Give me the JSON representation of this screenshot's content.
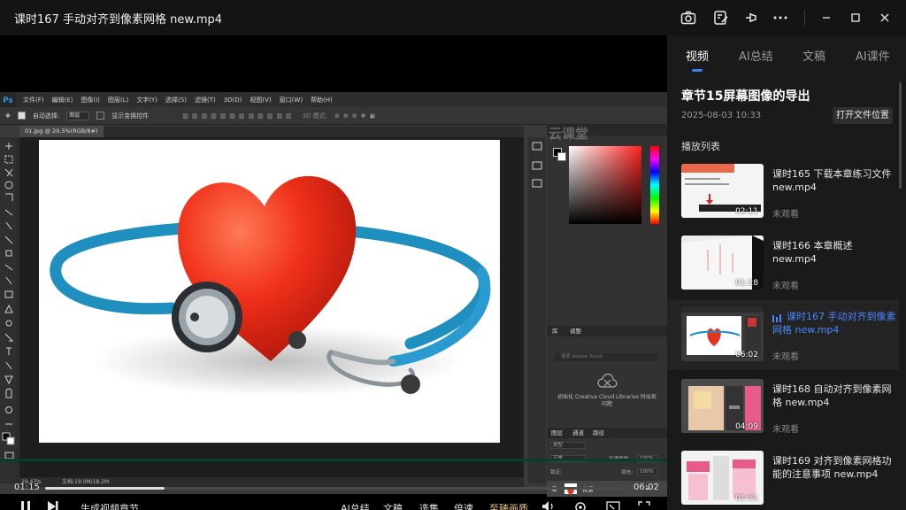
{
  "window": {
    "title": "课时167 手动对齐到像素网格 new.mp4",
    "buttons": [
      "camera-icon",
      "edit-note-icon",
      "pin-icon",
      "more-icon",
      "minimize-icon",
      "maximize-icon",
      "close-icon"
    ]
  },
  "photoshop": {
    "logo": "Ps",
    "menus": [
      "文件(F)",
      "编辑(E)",
      "图像(I)",
      "图层(L)",
      "文字(Y)",
      "选择(S)",
      "滤镜(T)",
      "3D(D)",
      "视图(V)",
      "窗口(W)",
      "帮助(H)"
    ],
    "options": {
      "auto_select": "自动选择:",
      "layer_select": "图层",
      "show_transform": "显示变换控件",
      "mode_3d": "3D 模式:"
    },
    "doc_tab": "01.jpg @ 29.5%(RGB/8#)",
    "status_zoom": "29.47%",
    "status_doc": "文档:19.0M/18.2M",
    "panel_tabs_lib": [
      "库",
      "调整"
    ],
    "lib_search": "搜索 Adobe Stock",
    "lib_message": "初始化 Creative Cloud Libraries 时出现问题",
    "layer_tabs": [
      "图层",
      "通道",
      "路径"
    ],
    "layer_kind": "类型",
    "layer_blend": "正常",
    "layer_opacity_label": "不透明度:",
    "layer_opacity": "100%",
    "layer_lock_label": "锁定:",
    "layer_fill_label": "填充:",
    "layer_fill": "100%",
    "layer_name": "背景"
  },
  "watermark": "云课堂",
  "player": {
    "current_time": "01:15",
    "duration": "06:02",
    "progress": 0.207,
    "controls": {
      "generate": "生成视频章节",
      "ai_summary": "AI总结",
      "transcript": "文稿",
      "select_episode": "选集",
      "speed": "倍速",
      "quality": "至臻画质"
    }
  },
  "sidebar": {
    "tabs": [
      "视频",
      "AI总结",
      "文稿",
      "AI课件"
    ],
    "active_tab": 0,
    "chapter_title": "章节15屏幕图像的导出",
    "chapter_date": "2025-08-03 10:33",
    "open_location": "打开文件位置",
    "playlist_label": "播放列表",
    "accent": "#3d7bff",
    "items": [
      {
        "title": "课时165 下载本章练习文件 new.mp4",
        "duration": "02:11",
        "status": "未观看"
      },
      {
        "title": "课时166 本章概述 new.mp4",
        "duration": "01:28",
        "status": "未观看"
      },
      {
        "title": "课时167 手动对齐到像素网格 new.mp4",
        "duration": "06:02",
        "status": "未观看",
        "current": true
      },
      {
        "title": "课时168 自动对齐到像素网格 new.mp4",
        "duration": "04:09",
        "status": "未观看"
      },
      {
        "title": "课时169 对齐到像素网格功能的注意事项 new.mp4",
        "duration": "01:51",
        "status": ""
      }
    ]
  }
}
